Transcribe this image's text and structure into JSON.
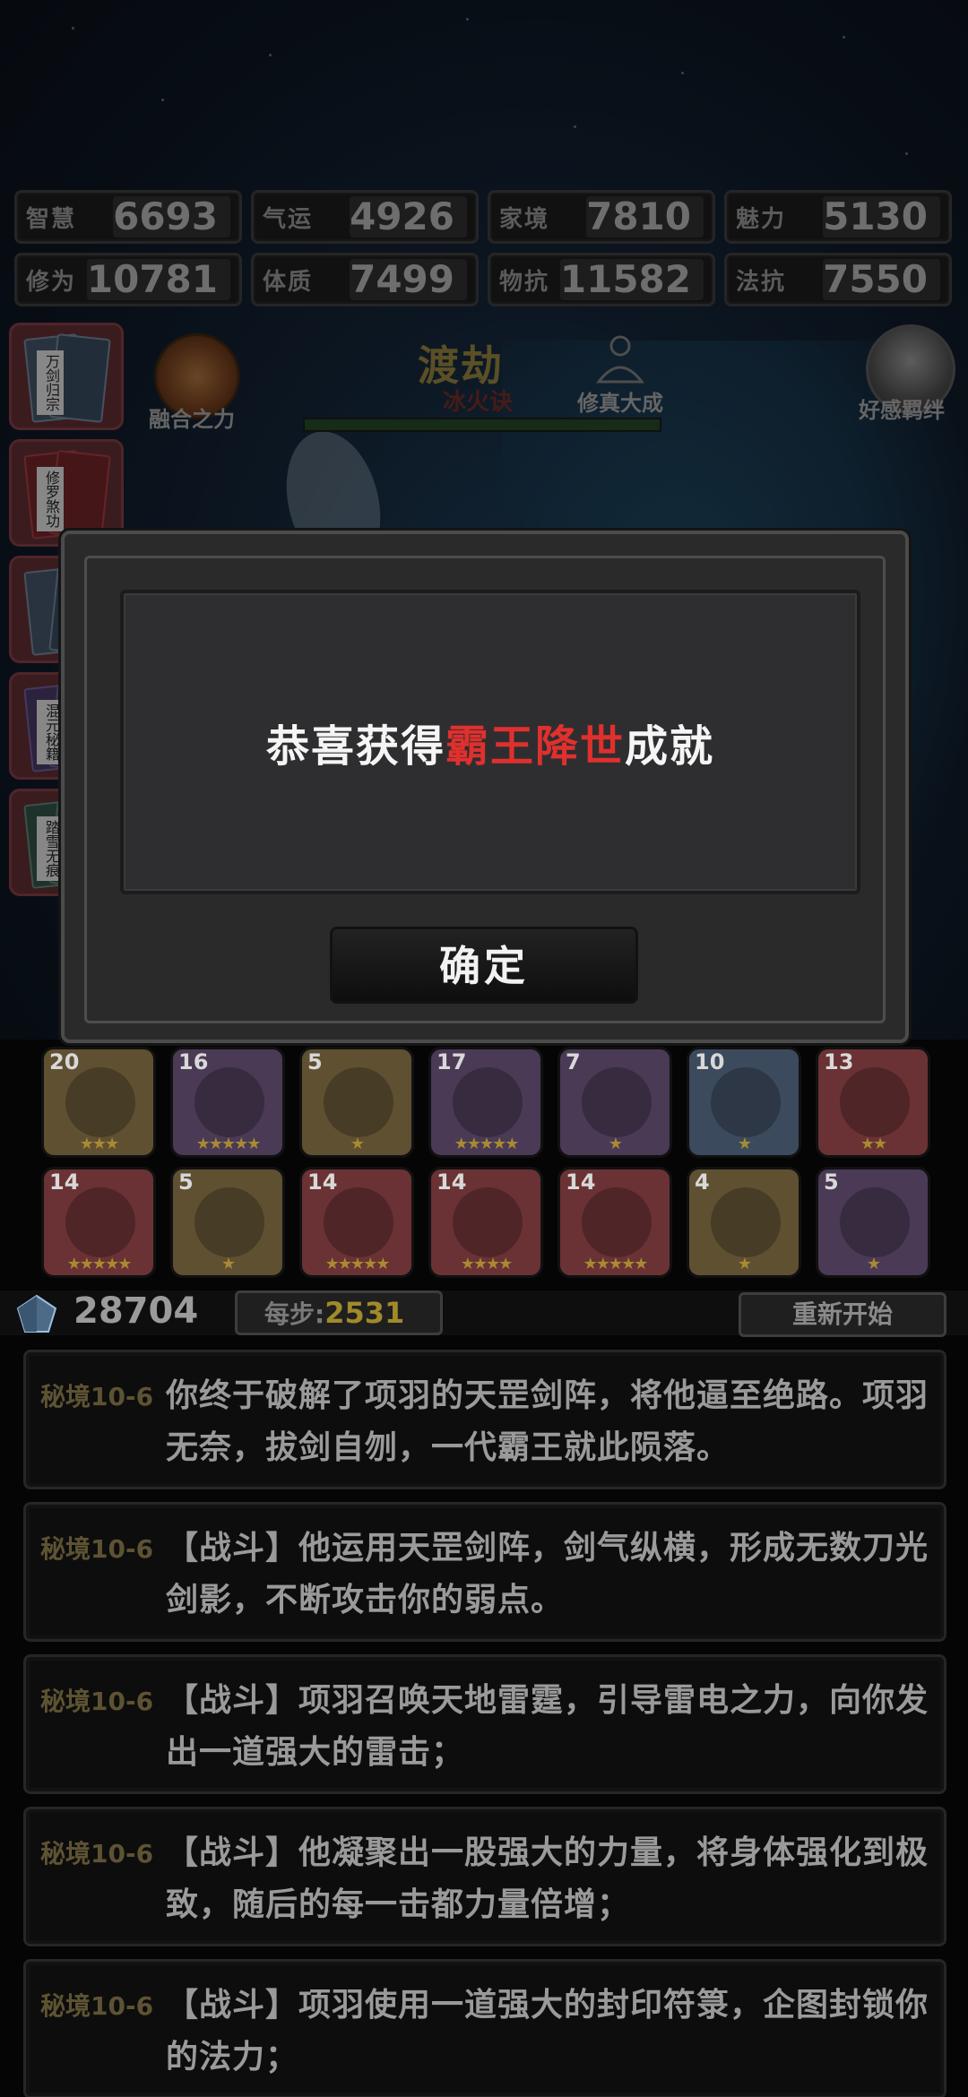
{
  "stats": [
    [
      {
        "label": "智慧",
        "value": "6693"
      },
      {
        "label": "气运",
        "value": "4926"
      },
      {
        "label": "家境",
        "value": "7810"
      },
      {
        "label": "魅力",
        "value": "5130"
      }
    ],
    [
      {
        "label": "修为",
        "value": "10781"
      },
      {
        "label": "体质",
        "value": "7499"
      },
      {
        "label": "物抗",
        "value": "11582"
      },
      {
        "label": "法抗",
        "value": "7550"
      }
    ]
  ],
  "books": [
    {
      "title": "万剑归宗",
      "color": "blue"
    },
    {
      "title": "修罗煞功",
      "color": "red"
    },
    {
      "title": "",
      "color": "blue"
    },
    {
      "title": "混元秘籍",
      "color": "purple"
    },
    {
      "title": "踏雪无痕",
      "color": "green"
    }
  ],
  "skill": {
    "label": "融合之力"
  },
  "stage": {
    "title": "渡劫",
    "subtitle": "冰火诀",
    "icon_label": "修真大成",
    "portrait_label": "好感羁绊"
  },
  "dialog": {
    "prefix": "恭喜获得",
    "highlight": "霸王降世",
    "suffix": "成就",
    "confirm_label": "确定"
  },
  "items": [
    [
      {
        "count": "20",
        "rarity": "gold",
        "stars": "★★★",
        "icon": "claw-icon"
      },
      {
        "count": "16",
        "rarity": "purple",
        "stars": "★★★★★",
        "icon": "gourd-icon"
      },
      {
        "count": "5",
        "rarity": "gold",
        "stars": "★",
        "icon": "mace-icon"
      },
      {
        "count": "17",
        "rarity": "purple",
        "stars": "★★★★★",
        "icon": "leaf-icon"
      },
      {
        "count": "7",
        "rarity": "purple",
        "stars": "★",
        "icon": "ring-icon"
      },
      {
        "count": "10",
        "rarity": "blue",
        "stars": "★",
        "icon": "crystal-icon"
      },
      {
        "count": "13",
        "rarity": "red",
        "stars": "★★",
        "icon": "seal-icon"
      }
    ],
    [
      {
        "count": "14",
        "rarity": "red",
        "stars": "★★★★★",
        "icon": "axe-icon"
      },
      {
        "count": "5",
        "rarity": "gold",
        "stars": "★",
        "icon": "sword-icon"
      },
      {
        "count": "14",
        "rarity": "red",
        "stars": "★★★★★",
        "icon": "blade-icon"
      },
      {
        "count": "14",
        "rarity": "red",
        "stars": "★★★★",
        "icon": "spear-icon"
      },
      {
        "count": "14",
        "rarity": "red",
        "stars": "★★★★★",
        "icon": "cauldron-icon"
      },
      {
        "count": "4",
        "rarity": "gold",
        "stars": "★",
        "icon": "yin-yang-icon"
      },
      {
        "count": "5",
        "rarity": "purple",
        "stars": "★",
        "icon": "weapon-icon"
      }
    ]
  ],
  "resources": {
    "gems": "28704",
    "step_label": "每步:",
    "step_value": "2531",
    "restart_label": "重新开始"
  },
  "log": [
    {
      "tag": "秘境10-6",
      "text": "你终于破解了项羽的天罡剑阵，将他逼至绝路。项羽无奈，拔剑自刎，一代霸王就此陨落。"
    },
    {
      "tag": "秘境10-6",
      "text": "【战斗】他运用天罡剑阵，剑气纵横，形成无数刀光剑影，不断攻击你的弱点。"
    },
    {
      "tag": "秘境10-6",
      "text": "【战斗】项羽召唤天地雷霆，引导雷电之力，向你发出一道强大的雷击；"
    },
    {
      "tag": "秘境10-6",
      "text": "【战斗】他凝聚出一股强大的力量，将身体强化到极致，随后的每一击都力量倍增；"
    },
    {
      "tag": "秘境10-6",
      "text": "【战斗】项羽使用一道强大的封印符箓，企图封锁你的法力；"
    }
  ],
  "colors": {
    "highlight": "#e0302e",
    "gold_value": "#a08a2a"
  }
}
